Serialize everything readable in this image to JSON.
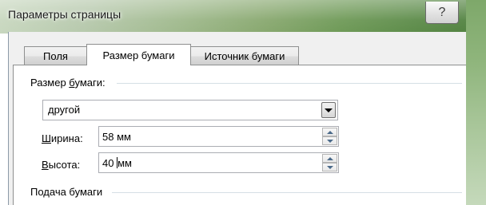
{
  "window": {
    "title": "Параметры страницы",
    "help_glyph": "?"
  },
  "tabs": [
    {
      "label": "Поля",
      "active": false
    },
    {
      "label": "Размер бумаги",
      "active": true
    },
    {
      "label": "Источник бумаги",
      "active": false
    }
  ],
  "paper_size": {
    "group_label_pre": "Размер ",
    "group_label_accel": "б",
    "group_label_post": "умаги:",
    "selected": "другой"
  },
  "width": {
    "label_accel": "Ш",
    "label_rest": "ирина:",
    "value": "58 мм"
  },
  "height": {
    "label_accel": "В",
    "label_rest": "ысота:",
    "value_before_caret": "40 ",
    "value_after_caret": "мм"
  },
  "paper_feed": {
    "group_label": "Подача бумаги"
  },
  "icons": {
    "dropdown": "chevron-down-icon",
    "spin_up": "triangle-up-icon",
    "spin_down": "triangle-down-icon",
    "help": "question-mark-icon"
  }
}
